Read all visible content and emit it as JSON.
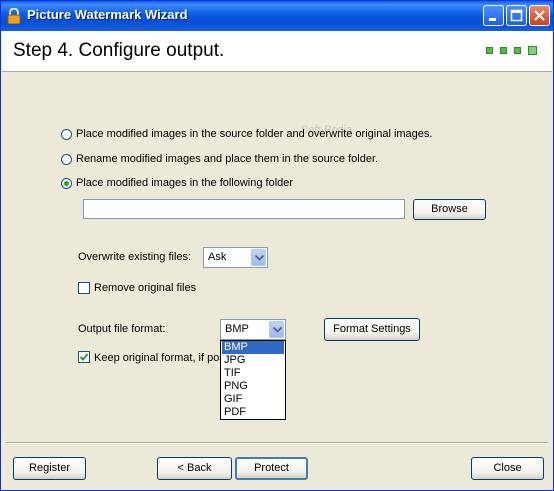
{
  "window": {
    "title": "Picture Watermark Wizard"
  },
  "header": {
    "step_title": "Step 4. Configure output.",
    "progress_steps_total": 4,
    "progress_current": 4
  },
  "output_options": [
    {
      "label": "Place modified images in the source folder and overwrite original images.",
      "selected": false
    },
    {
      "label": "Rename modified images and place them in the source folder.",
      "selected": false
    },
    {
      "label": "Place modified images in the following folder",
      "selected": true
    }
  ],
  "folder": {
    "value": "",
    "browse_label": "Browse"
  },
  "overwrite": {
    "label": "Overwrite existing files:",
    "value": "Ask"
  },
  "remove_original": {
    "label": "Remove original files",
    "checked": false
  },
  "format": {
    "label": "Output file format:",
    "value": "BMP",
    "settings_label": "Format Settings",
    "options": [
      "BMP",
      "JPG",
      "TIF",
      "PNG",
      "GIF",
      "PDF"
    ],
    "highlighted": "BMP"
  },
  "keep_format": {
    "label": "Keep original format, if pos",
    "checked": true
  },
  "footer": {
    "register_label": "Register",
    "back_label": "< Back",
    "protect_label": "Protect",
    "close_label": "Close"
  },
  "colors": {
    "title_bar": "#0450D5",
    "selection": "#316AC5",
    "progress_dot": "#55B84A",
    "face": "#ECE9D8"
  }
}
